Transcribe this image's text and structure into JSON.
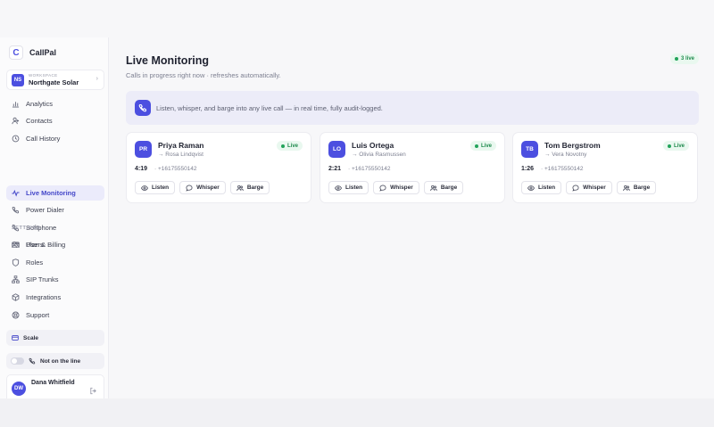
{
  "app": {
    "name": "CallPal",
    "logo_glyph": "C"
  },
  "workspace": {
    "caption": "WORKSPACE",
    "initials": "NS",
    "name": "Northgate Solar"
  },
  "nav": [
    {
      "label": "Analytics",
      "icon": "chart-icon"
    },
    {
      "label": "Contacts",
      "icon": "contacts-icon"
    },
    {
      "label": "Call History",
      "icon": "history-icon"
    },
    {
      "label": "Live Monitoring",
      "icon": "pulse-icon",
      "active": true
    },
    {
      "label": "Power Dialer",
      "icon": "dialer-icon"
    },
    {
      "label": "Softphone",
      "icon": "phone-icon"
    },
    {
      "label": "Users",
      "icon": "users-icon"
    }
  ],
  "settings_label": "SETTINGS",
  "settings": [
    {
      "label": "Plan & Billing",
      "icon": "card-icon"
    },
    {
      "label": "Roles",
      "icon": "shield-icon"
    },
    {
      "label": "SIP Trunks",
      "icon": "network-icon"
    },
    {
      "label": "Integrations",
      "icon": "cube-icon"
    },
    {
      "label": "Support",
      "icon": "support-icon"
    }
  ],
  "plan": {
    "label": "Scale"
  },
  "line_status": {
    "label": "Not on the line"
  },
  "user": {
    "initials": "DW",
    "name": "Dana Whitfield"
  },
  "page": {
    "title": "Live Monitoring",
    "subtitle": "Calls in progress right now · refreshes automatically.",
    "live_count": "3 live",
    "banner": "Listen, whisper, and barge into any live call — in real time, fully audit-logged."
  },
  "calls": [
    {
      "initials": "PR",
      "name": "Priya Raman",
      "to": "→ Rosa Lindqvist",
      "status": "Live",
      "duration": "4:19",
      "phone": "· +16175550142"
    },
    {
      "initials": "LO",
      "name": "Luis Ortega",
      "to": "→ Olivia Rasmussen",
      "status": "Live",
      "duration": "2:21",
      "phone": "· +16175550142"
    },
    {
      "initials": "TB",
      "name": "Tom Bergstrom",
      "to": "→ Vera Novotny",
      "status": "Live",
      "duration": "1:26",
      "phone": "· +16175550142"
    }
  ],
  "actions": {
    "listen": "Listen",
    "whisper": "Whisper",
    "barge": "Barge"
  },
  "colors": {
    "accent": "#4c4fe0",
    "live_green": "#22a35a",
    "live_bg": "#e9f8ef",
    "active_nav_bg": "#ebebfb",
    "banner_bg": "#ececf8"
  }
}
